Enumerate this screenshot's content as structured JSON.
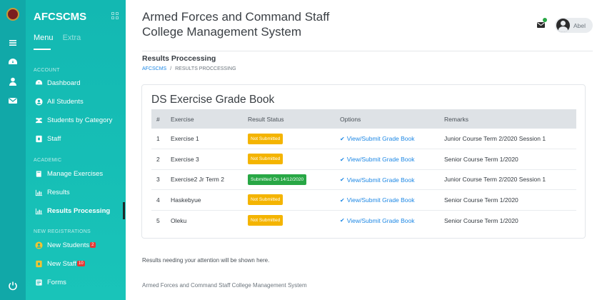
{
  "brand": "AFCSCMS",
  "sidebar": {
    "tabs": [
      "Menu",
      "Extra"
    ],
    "sections": {
      "account": "ACCOUNT",
      "academic": "ACADEMIC",
      "registrations": "NEW REGISTRATIONS"
    },
    "items": [
      {
        "label": "Dashboard",
        "icon": "dashboard-icon"
      },
      {
        "label": "All Students",
        "icon": "user-circle-icon"
      },
      {
        "label": "Students by Category",
        "icon": "users-icon"
      },
      {
        "label": "Staff",
        "icon": "id-card-icon"
      },
      {
        "label": "Manage Exercises",
        "icon": "book-icon"
      },
      {
        "label": "Results",
        "icon": "bar-chart-icon"
      },
      {
        "label": "Results Processing",
        "icon": "bar-chart-icon"
      },
      {
        "label": "New Students",
        "icon": "user-circle-icon",
        "badge": "2"
      },
      {
        "label": "New Staff",
        "icon": "id-card-icon",
        "badge": "10"
      },
      {
        "label": "Forms",
        "icon": "form-icon"
      }
    ]
  },
  "header": {
    "title_line1": "Armed Forces and Command Staff",
    "title_line2": "College Management System",
    "user_name": "Abel"
  },
  "page": {
    "title": "Results Proccessing",
    "breadcrumb_root": "AFCSCMS",
    "breadcrumb_sep": "/",
    "breadcrumb_current": "RESULTS PROCCESSING"
  },
  "card": {
    "title": "DS Exercise Grade Book",
    "columns": [
      "#",
      "Exercise",
      "Result Status",
      "Options",
      "Remarks"
    ],
    "rows": [
      {
        "num": "1",
        "exercise": "Exercise 1",
        "status": "Not Submitted",
        "status_kind": "warn",
        "option": "View/Submit Grade Book",
        "remarks": "Junior Course Term 2/2020 Session 1"
      },
      {
        "num": "2",
        "exercise": "Exercise 3",
        "status": "Not Submitted",
        "status_kind": "warn",
        "option": "View/Submit Grade Book",
        "remarks": "Senior Course Term 1/2020"
      },
      {
        "num": "3",
        "exercise": "Exercise2 Jr Term 2",
        "status": "Submitted On 14/12/2020",
        "status_kind": "ok",
        "option": "View/Submit Grade Book",
        "remarks": "Junior Course Term 2/2020 Session 1"
      },
      {
        "num": "4",
        "exercise": "Haskebyue",
        "status": "Not Submitted",
        "status_kind": "warn",
        "option": "View/Submit Grade Book",
        "remarks": "Senior Course Term 1/2020"
      },
      {
        "num": "5",
        "exercise": "Oleku",
        "status": "Not Submitted",
        "status_kind": "warn",
        "option": "View/Submit Grade Book",
        "remarks": "Senior Course Term 1/2020"
      }
    ]
  },
  "attention_text": "Results needing your attention will be shown here.",
  "footer_text": "Armed Forces and Command Staff College Management System",
  "colors": {
    "sidebar": "#13b8b2",
    "accent": "#1e88e5",
    "warn": "#f4b400",
    "success": "#28a745"
  }
}
